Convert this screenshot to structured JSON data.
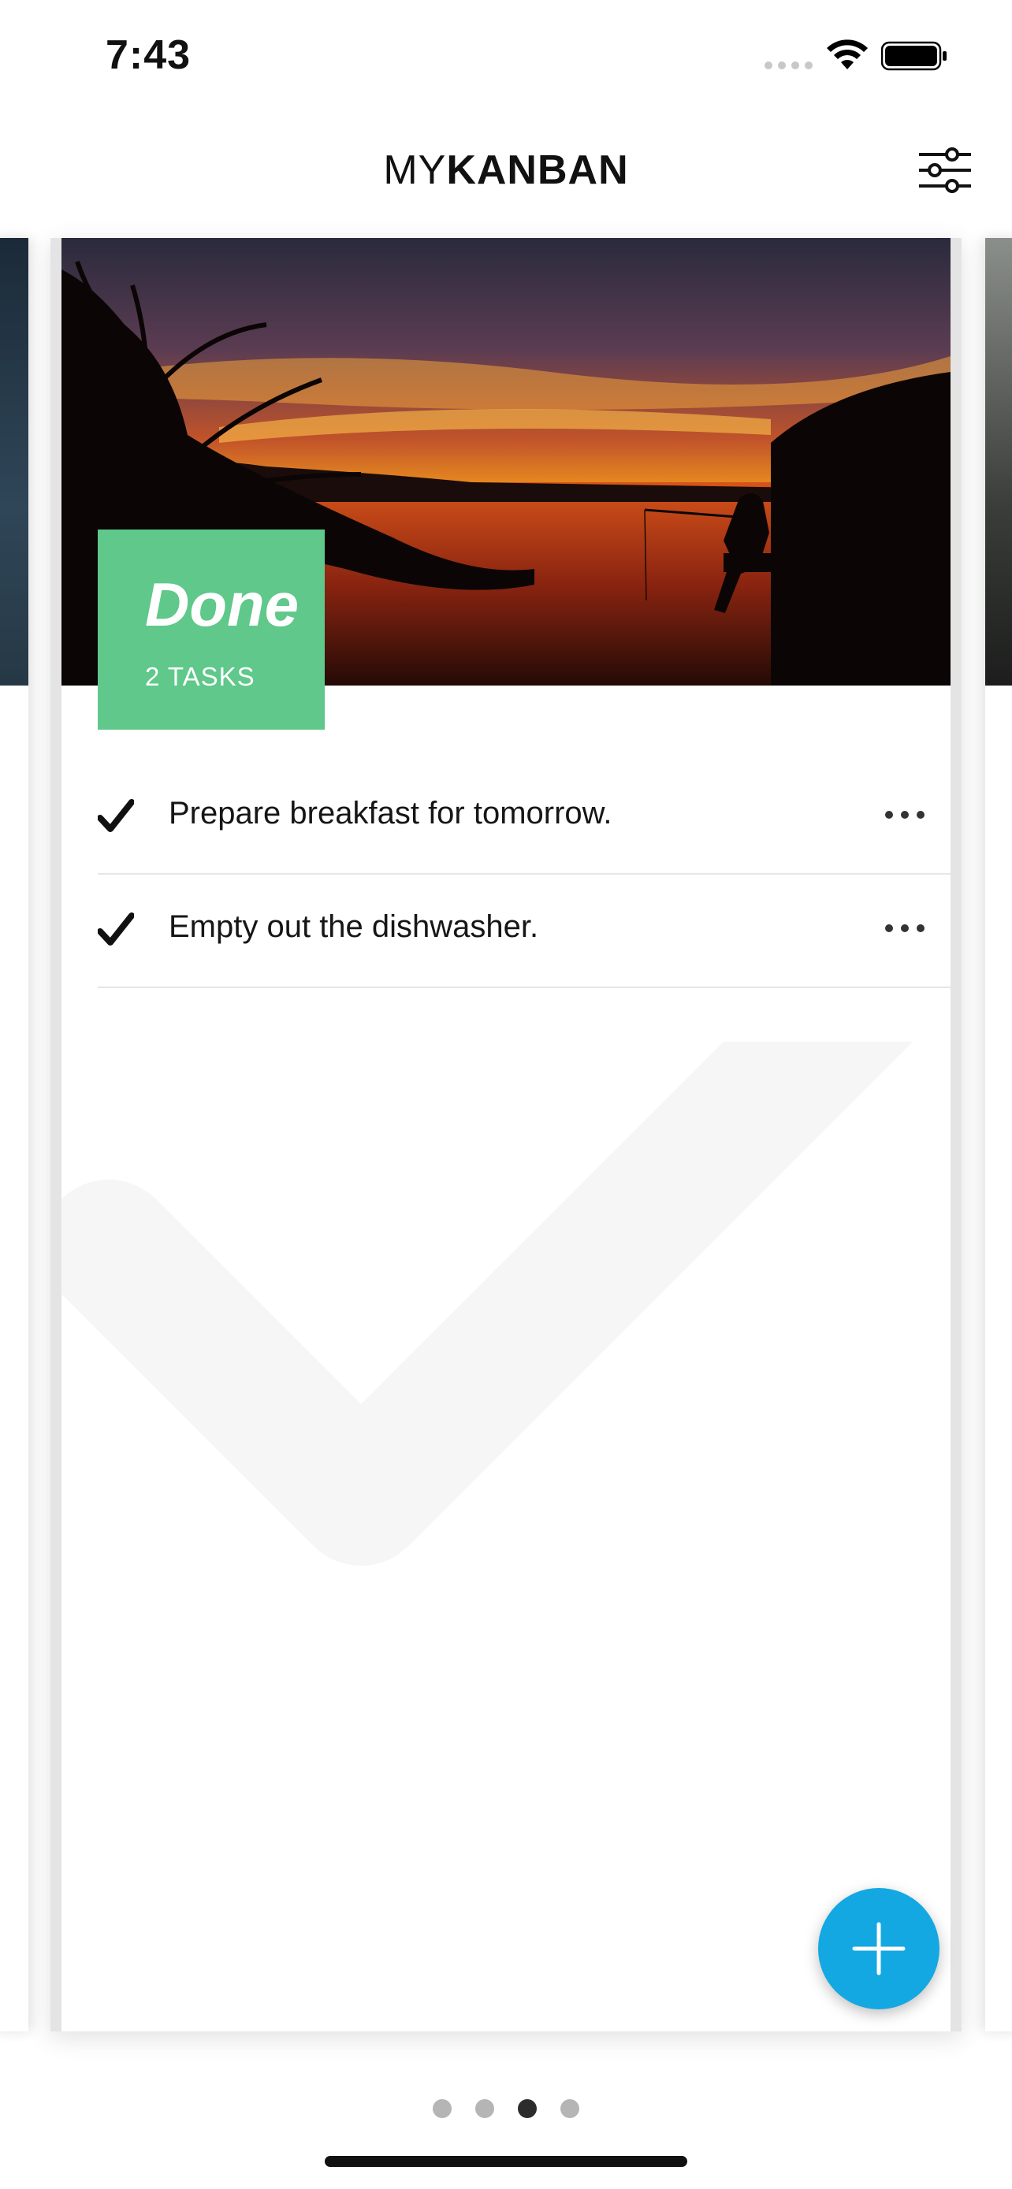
{
  "status_bar": {
    "time": "7:43"
  },
  "header": {
    "logo_light": "MY",
    "logo_bold": "KANBAN"
  },
  "column": {
    "title": "Done",
    "task_count": "2 TASKS"
  },
  "tasks": [
    {
      "text": "Prepare breakfast for tomorrow."
    },
    {
      "text": "Empty out the dishwasher."
    }
  ],
  "pager": {
    "pages": 4,
    "active_index": 2
  },
  "colors": {
    "badge": "#5fc88a",
    "fab": "#13a8e2",
    "pager_active": "#2c2c2c"
  }
}
